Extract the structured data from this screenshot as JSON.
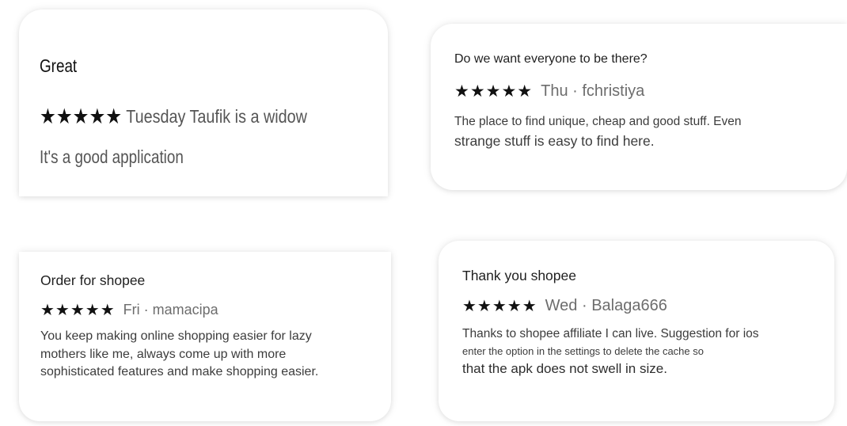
{
  "reviews": [
    {
      "title": "Great",
      "stars": "★★★★★",
      "meta": "Tuesday Taufik is a widow",
      "body": [
        "It's a good application"
      ]
    },
    {
      "title": "Do we want everyone to be there?",
      "stars": "★★★★★",
      "meta": "Thu · fchristiya",
      "body": [
        "The place to find unique, cheap and good stuff. Even",
        "strange stuff is easy to find here."
      ]
    },
    {
      "title": "Order for shopee",
      "stars": "★★★★★",
      "meta": "Fri · mamacipa",
      "body": [
        "You keep making online shopping easier for lazy",
        "mothers like me, always come up with more",
        "sophisticated features and make shopping easier."
      ]
    },
    {
      "title": "Thank you shopee",
      "stars": "★★★★★",
      "meta": "Wed · Balaga666",
      "body": [
        "Thanks to shopee affiliate I can live. Suggestion for ios",
        "enter the option in the settings to delete the cache so",
        "that the apk does not swell in size."
      ]
    }
  ],
  "rating_value": 5,
  "rating_max": 5,
  "icons": {
    "star": "star-icon"
  }
}
